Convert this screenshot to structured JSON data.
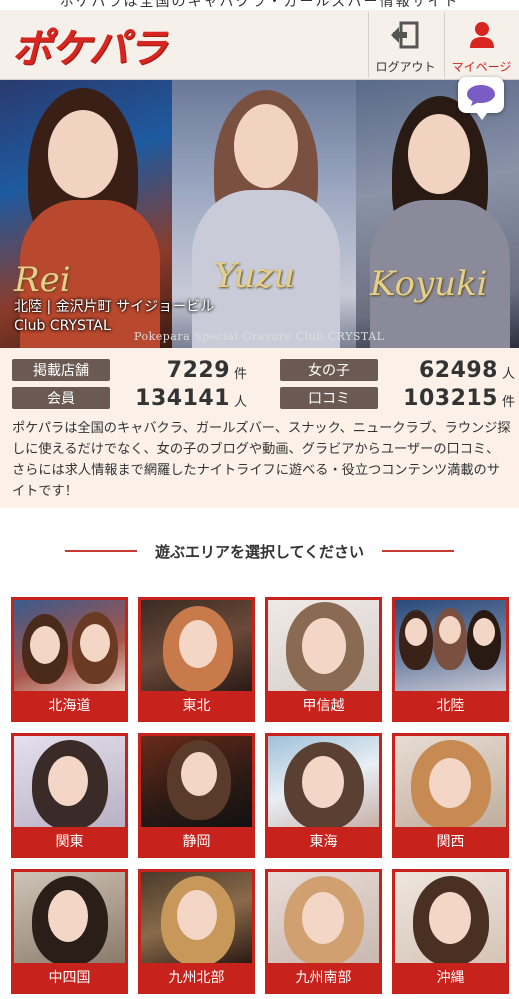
{
  "header": {
    "logo": "ポケパラ",
    "logout_label": "ログアウト",
    "mypage_label": "マイページ",
    "top_strip_text": "ポケパラは全国のキャバクラ・ガールズバー情報サイト"
  },
  "banner": {
    "location": "北陸 | 金沢片町 サイジョービル",
    "club": "Club CRYSTAL",
    "caption": "Pokepara Special Gravure   Club CRYSTAL",
    "signatures": [
      "Rei",
      "Yuzu",
      "Koyuki"
    ]
  },
  "stats": [
    {
      "label": "掲載店舗",
      "value": "7229",
      "unit": "件"
    },
    {
      "label": "女の子",
      "value": "62498",
      "unit": "人"
    },
    {
      "label": "会員",
      "value": "134141",
      "unit": "人"
    },
    {
      "label": "口コミ",
      "value": "103215",
      "unit": "件"
    }
  ],
  "description": "ポケパラは全国のキャバクラ、ガールズバー、スナック、ニュークラブ、ラウンジ探しに使えるだけでなく、女の子のブログや動画、グラビアからユーザーの口コミ、さらには求人情報まで網羅したナイトライフに遊べる・役立つコンテンツ満載のサイトです！",
  "area_section": {
    "title": "遊ぶエリアを選択してください",
    "areas": [
      "北海道",
      "東北",
      "甲信越",
      "北陸",
      "関東",
      "静岡",
      "東海",
      "関西",
      "中四国",
      "九州北部",
      "九州南部",
      "沖縄"
    ]
  },
  "colors": {
    "brand_red": "#d7261f",
    "tile_red": "#c8221c",
    "stat_tag": "#6a5a52",
    "stats_bg": "#fbf1e8"
  }
}
